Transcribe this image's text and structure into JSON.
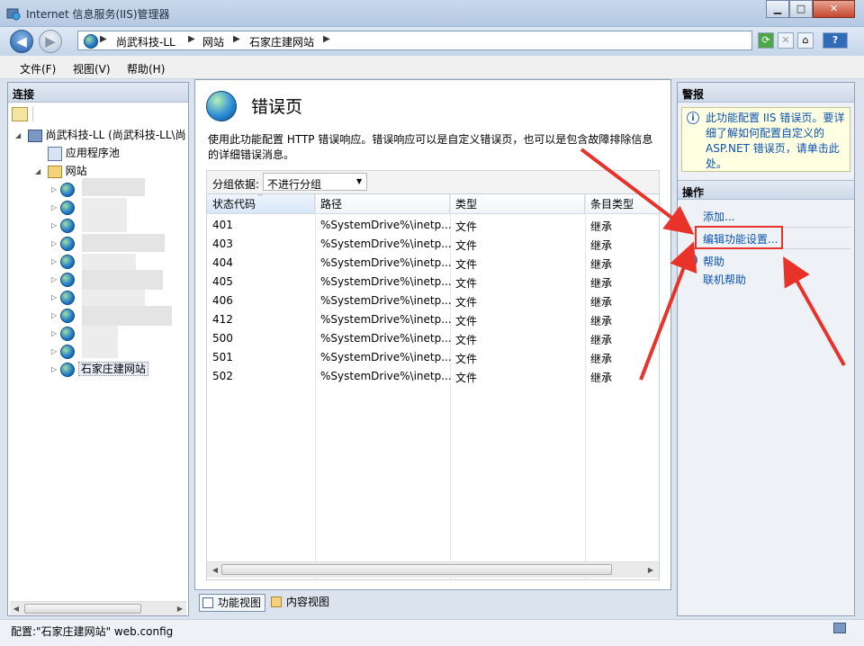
{
  "window": {
    "title": "Internet 信息服务(IIS)管理器",
    "minimize_glyph": "▁",
    "maximize_glyph": "□",
    "close_glyph": "✕"
  },
  "nav": {
    "back_glyph": "◀",
    "forward_glyph": "▶",
    "breadcrumbs": [
      "尚武科技-LL",
      "网站",
      "石家庄建网站"
    ],
    "separator": "▶",
    "help_glyph": "?"
  },
  "menu": {
    "items": [
      "文件(F)",
      "视图(V)",
      "帮助(H)"
    ]
  },
  "connections": {
    "header": "连接",
    "tree": {
      "server": "尚武科技-LL (尚武科技-LL\\尚",
      "app_pools": "应用程序池",
      "sites": "网站",
      "selected_site": "石家庄建网站"
    },
    "status": "配置:\"石家庄建网站\" web.config"
  },
  "main": {
    "title": "错误页",
    "description": "使用此功能配置 HTTP 错误响应。错误响应可以是自定义错误页，也可以是包含故障排除信息的详细错误消息。",
    "group_by_label": "分组依据:",
    "group_by_value": "不进行分组",
    "columns": [
      "状态代码",
      "路径",
      "类型",
      "条目类型"
    ],
    "rows": [
      {
        "code": "401",
        "path": "%SystemDrive%\\inetp...",
        "type": "文件",
        "entry": "继承"
      },
      {
        "code": "403",
        "path": "%SystemDrive%\\inetp...",
        "type": "文件",
        "entry": "继承"
      },
      {
        "code": "404",
        "path": "%SystemDrive%\\inetp...",
        "type": "文件",
        "entry": "继承"
      },
      {
        "code": "405",
        "path": "%SystemDrive%\\inetp...",
        "type": "文件",
        "entry": "继承"
      },
      {
        "code": "406",
        "path": "%SystemDrive%\\inetp...",
        "type": "文件",
        "entry": "继承"
      },
      {
        "code": "412",
        "path": "%SystemDrive%\\inetp...",
        "type": "文件",
        "entry": "继承"
      },
      {
        "code": "500",
        "path": "%SystemDrive%\\inetp...",
        "type": "文件",
        "entry": "继承"
      },
      {
        "code": "501",
        "path": "%SystemDrive%\\inetp...",
        "type": "文件",
        "entry": "继承"
      },
      {
        "code": "502",
        "path": "%SystemDrive%\\inetp...",
        "type": "文件",
        "entry": "继承"
      }
    ],
    "view_tabs": [
      "功能视图",
      "内容视图"
    ]
  },
  "actions": {
    "alerts_header": "警报",
    "alert_text": "此功能配置 IIS 错误页。要详细了解如何配置自定义的 ASP.NET 错误页，请单击此处。",
    "actions_header": "操作",
    "add": "添加...",
    "edit_settings": "编辑功能设置...",
    "help": "帮助",
    "online_help": "联机帮助"
  },
  "colors": {
    "annotation_red": "#e8322a",
    "link_blue": "#0a52b4",
    "alert_bg": "#ffffe1"
  }
}
